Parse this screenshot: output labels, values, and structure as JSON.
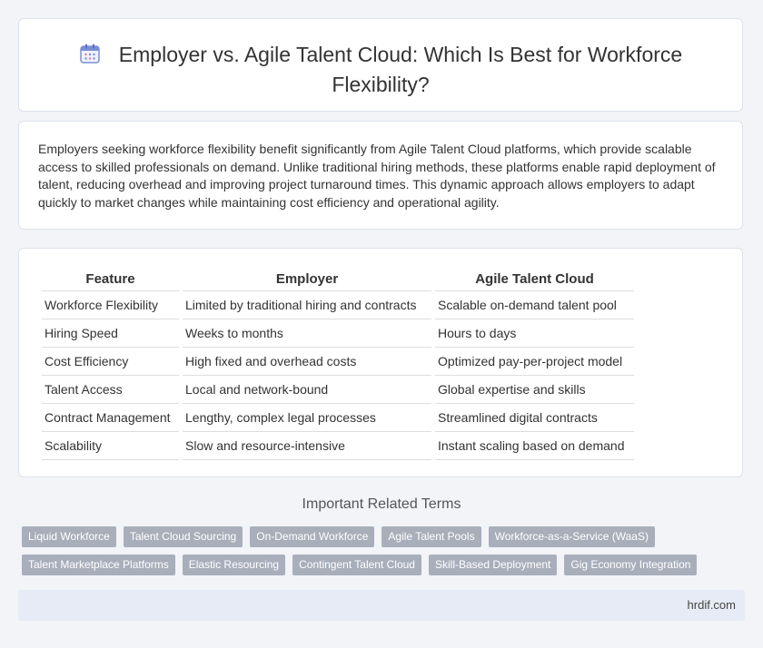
{
  "header": {
    "title": "Employer vs. Agile Talent Cloud: Which Is Best for Workforce Flexibility?",
    "icon": "calendar-icon"
  },
  "intro": {
    "text": "Employers seeking workforce flexibility benefit significantly from Agile Talent Cloud platforms, which provide scalable access to skilled professionals on demand. Unlike traditional hiring methods, these platforms enable rapid deployment of talent, reducing overhead and improving project turnaround times. This dynamic approach allows employers to adapt quickly to market changes while maintaining cost efficiency and operational agility."
  },
  "table": {
    "headers": [
      "Feature",
      "Employer",
      "Agile Talent Cloud"
    ],
    "rows": [
      [
        "Workforce Flexibility",
        "Limited by traditional hiring and contracts",
        "Scalable on-demand talent pool"
      ],
      [
        "Hiring Speed",
        "Weeks to months",
        "Hours to days"
      ],
      [
        "Cost Efficiency",
        "High fixed and overhead costs",
        "Optimized pay-per-project model"
      ],
      [
        "Talent Access",
        "Local and network-bound",
        "Global expertise and skills"
      ],
      [
        "Contract Management",
        "Lengthy, complex legal processes",
        "Streamlined digital contracts"
      ],
      [
        "Scalability",
        "Slow and resource-intensive",
        "Instant scaling based on demand"
      ]
    ]
  },
  "related": {
    "heading": "Important Related Terms",
    "row1": [
      "Liquid Workforce",
      "Talent Cloud Sourcing",
      "On-Demand Workforce",
      "Agile Talent Pools",
      "Workforce-as-a-Service (WaaS)"
    ],
    "row2": [
      "Talent Marketplace Platforms",
      "Elastic Resourcing",
      "Contingent Talent Cloud",
      "Skill-Based Deployment",
      "Gig Economy Integration"
    ]
  },
  "footer": {
    "site": "hrdif.com"
  },
  "colors": {
    "tag_bg": "#a8afbb",
    "page_bg": "#f2f4f8",
    "footer_bg": "#e6ebf5",
    "icon_accent": "#7b8fd6"
  }
}
